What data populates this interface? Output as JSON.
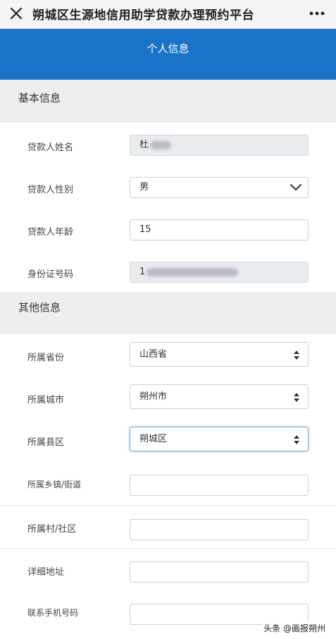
{
  "topbar": {
    "title": "朔城区生源地信用助学贷款办理预约平台",
    "close_icon": "close-icon",
    "more_icon": "more-dots-icon"
  },
  "header": {
    "title": "个人信息",
    "color": "#1a73c8"
  },
  "sections": {
    "basic": "基本信息",
    "other": "其他信息"
  },
  "basic_fields": {
    "name": {
      "label": "贷款人姓名",
      "value": "杜"
    },
    "gender": {
      "label": "贷款人性别",
      "value": "男"
    },
    "age": {
      "label": "贷款人年龄",
      "value": "15"
    },
    "id_number": {
      "label": "身份证号码",
      "value": "1"
    }
  },
  "other_fields": {
    "province": {
      "label": "所属省份",
      "value": "山西省"
    },
    "city": {
      "label": "所属城市",
      "value": "朔州市"
    },
    "county": {
      "label": "所属县区",
      "value": "朔城区"
    },
    "town": {
      "label": "所属乡镇/街道",
      "value": ""
    },
    "village": {
      "label": "所属村/社区",
      "value": ""
    },
    "address": {
      "label": "详细地址",
      "value": ""
    },
    "phone": {
      "label": "联系手机号码",
      "value": ""
    }
  },
  "watermark": "头条 @画报朔州"
}
